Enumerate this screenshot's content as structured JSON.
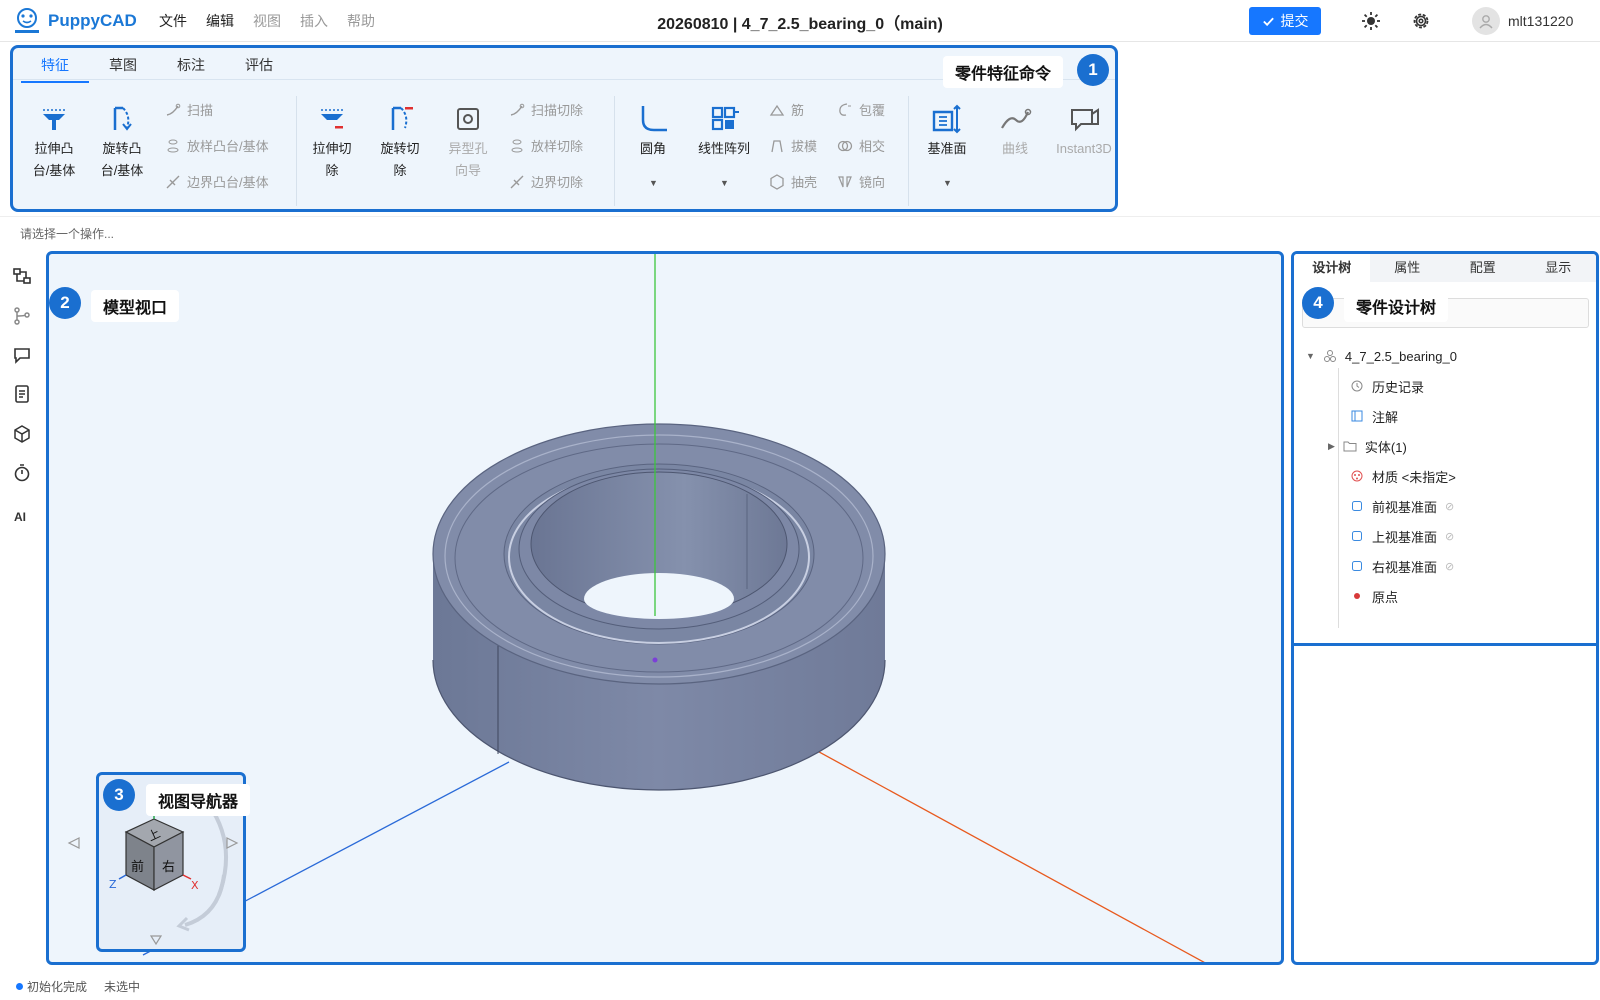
{
  "app": {
    "name": "PuppyCAD"
  },
  "menu": [
    {
      "label": "文件",
      "enabled": true
    },
    {
      "label": "编辑",
      "enabled": true
    },
    {
      "label": "视图",
      "enabled": false
    },
    {
      "label": "插入",
      "enabled": false
    },
    {
      "label": "帮助",
      "enabled": false
    }
  ],
  "document": {
    "title": "20260810 | 4_7_2.5_bearing_0（main)"
  },
  "toolbar": {
    "submit_label": "提交"
  },
  "user": {
    "name": "mlt131220"
  },
  "ribbon": {
    "tabs": [
      {
        "label": "特征",
        "active": true
      },
      {
        "label": "草图",
        "active": false
      },
      {
        "label": "标注",
        "active": false
      },
      {
        "label": "评估",
        "active": false
      }
    ],
    "commands": {
      "extrude_boss": {
        "line1": "拉伸凸",
        "line2": "台/基体"
      },
      "revolve_boss": {
        "line1": "旋转凸",
        "line2": "台/基体"
      },
      "sweep": "扫描",
      "loft_boss": "放样凸台/基体",
      "boundary_boss": "边界凸台/基体",
      "extrude_cut": {
        "line1": "拉伸切",
        "line2": "除"
      },
      "revolve_cut": {
        "line1": "旋转切",
        "line2": "除"
      },
      "hole_wizard": {
        "line1": "异型孔",
        "line2": "向导"
      },
      "sweep_cut": "扫描切除",
      "loft_cut": "放样切除",
      "boundary_cut": "边界切除",
      "fillet": "圆角",
      "linear_pattern": "线性阵列",
      "rib": "筋",
      "wrap": "包覆",
      "draft": "拔模",
      "intersect": "相交",
      "shell": "抽壳",
      "mirror": "镜向",
      "ref_plane": "基准面",
      "curves": "曲线",
      "instant3d": "Instant3D"
    },
    "callout": "零件特征命令",
    "callout_num": "1"
  },
  "hint": "请选择一个操作...",
  "viewport": {
    "callout": "模型视口",
    "callout_num": "2",
    "navigator": {
      "callout": "视图导航器",
      "callout_num": "3",
      "faces": {
        "top": "上",
        "front": "前",
        "right": "右"
      },
      "axes": {
        "x": "X",
        "z": "Z"
      }
    }
  },
  "lefttools": {
    "ai_label": "AI"
  },
  "rightpanel": {
    "tabs": [
      {
        "label": "设计树",
        "active": true
      },
      {
        "label": "属性",
        "active": false
      },
      {
        "label": "配置",
        "active": false
      },
      {
        "label": "显示",
        "active": false
      }
    ],
    "callout": "零件设计树",
    "callout_num": "4",
    "tree": {
      "root": "4_7_2.5_bearing_0",
      "items": [
        {
          "label": "历史记录"
        },
        {
          "label": "注解"
        },
        {
          "label": "实体(1)"
        },
        {
          "label": "材质 <未指定>"
        },
        {
          "label": "前视基准面"
        },
        {
          "label": "上视基准面"
        },
        {
          "label": "右视基准面"
        },
        {
          "label": "原点"
        }
      ]
    }
  },
  "status": {
    "init": "初始化完成",
    "selection": "未选中"
  },
  "colors": {
    "accent": "#1a6fd0",
    "primary_button": "#1677ff",
    "model": "#7d88a6",
    "axis_y": "#3cc63c",
    "axis_x": "#e85a1e",
    "axis_z": "#2a6ad8"
  }
}
